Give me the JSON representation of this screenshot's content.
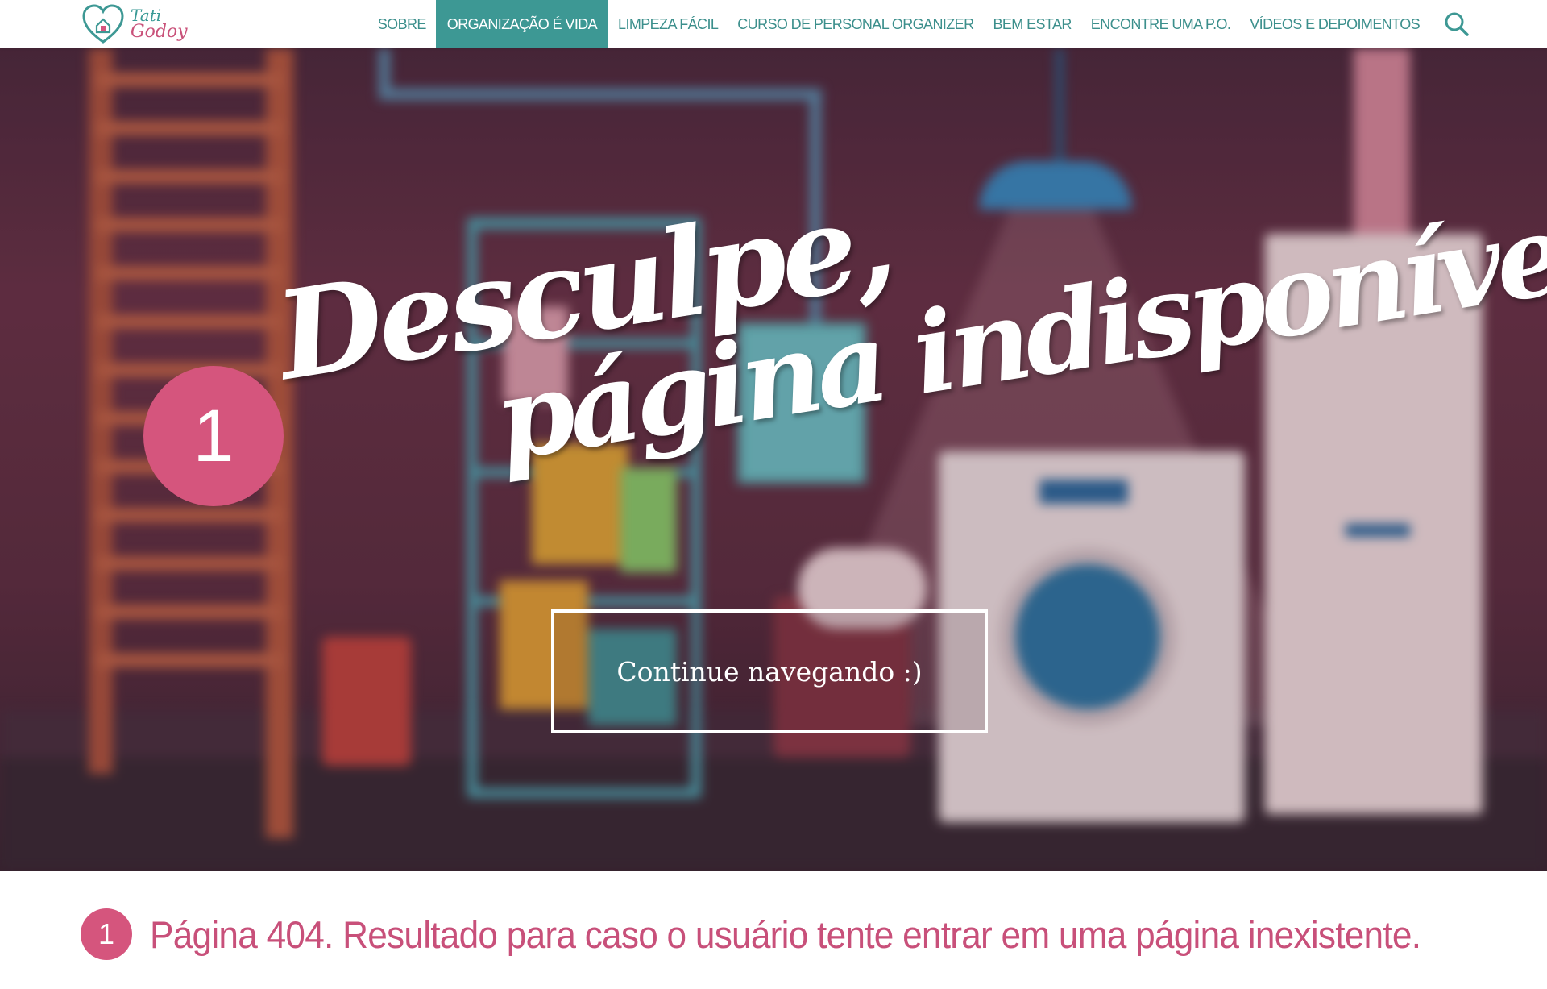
{
  "brand": {
    "logo_line1": "Tati",
    "logo_line2": "Godoy"
  },
  "nav": {
    "items": [
      {
        "label": "SOBRE",
        "active": false
      },
      {
        "label": "ORGANIZAÇÃO É VIDA",
        "active": true
      },
      {
        "label": "LIMPEZA FÁCIL",
        "active": false
      },
      {
        "label": "CURSO DE PERSONAL ORGANIZER",
        "active": false
      },
      {
        "label": "BEM ESTAR",
        "active": false
      },
      {
        "label": "ENCONTRE UMA P.O.",
        "active": false
      },
      {
        "label": "VÍDEOS E DEPOIMENTOS",
        "active": false
      }
    ],
    "search_icon": "search-icon"
  },
  "hero": {
    "title_line1": "Desculpe,",
    "title_line2": "página indisponível",
    "button_label": "Continue navegando :)",
    "marker": "1"
  },
  "caption": {
    "marker": "1",
    "text": "Página 404. Resultado para caso o usuário tente entrar em uma página inexistente."
  },
  "colors": {
    "teal": "#3d9894",
    "pink": "#d5557d",
    "caption_text": "#c8507a"
  }
}
